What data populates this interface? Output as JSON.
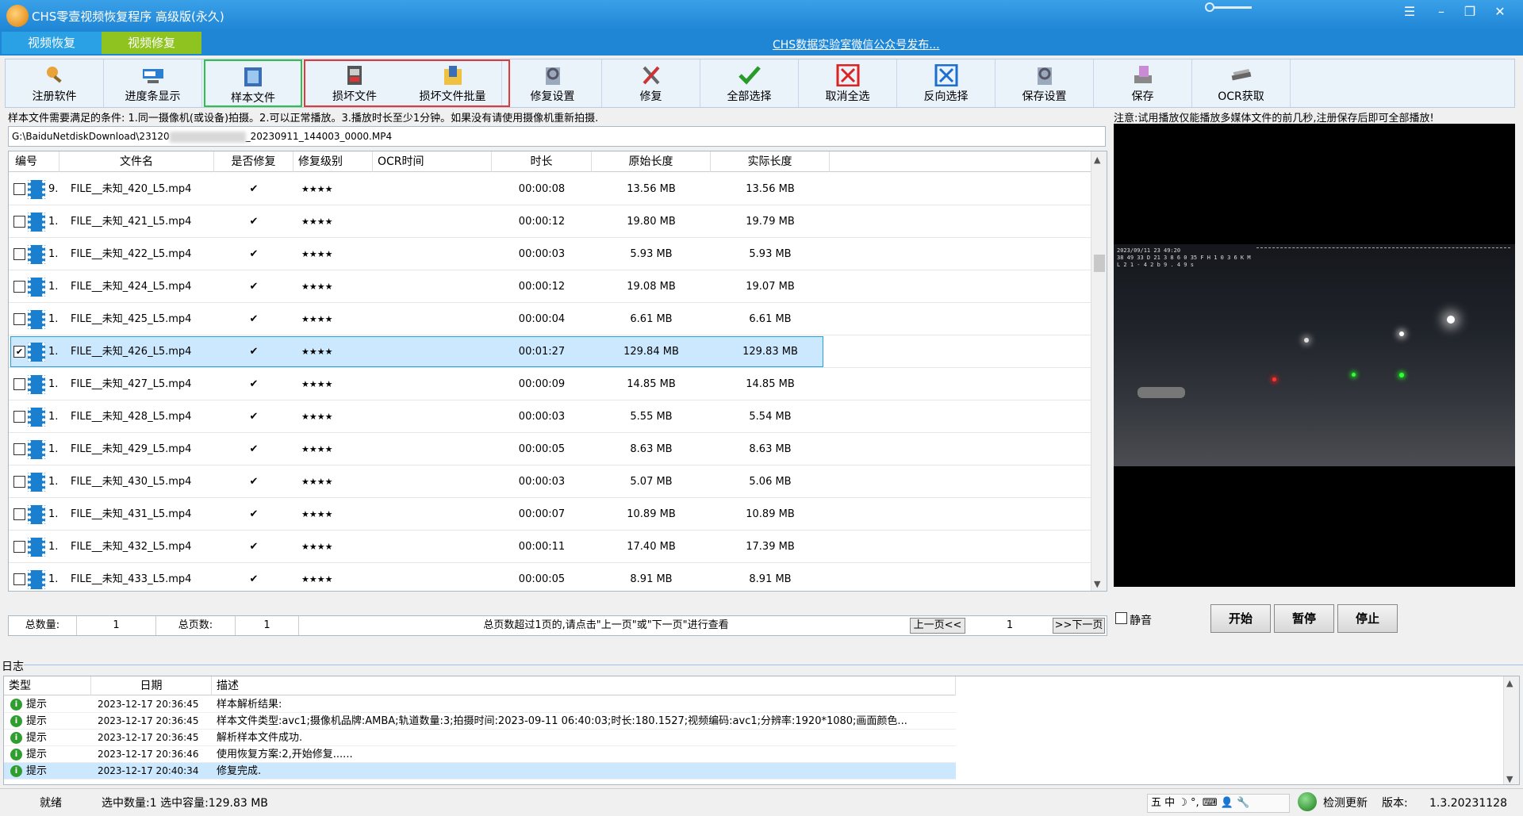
{
  "window": {
    "title": "CHS零壹视频恢复程序 高级版(永久)",
    "minimize": "–",
    "restore": "❐",
    "close": "✕",
    "menu": "☰"
  },
  "tabs": [
    {
      "label": "视频恢复"
    },
    {
      "label": "视频修复"
    }
  ],
  "promo_link": "CHS数据实验室微信公众号发布...",
  "toolbar": [
    {
      "label": "注册软件",
      "icon": "register-icon"
    },
    {
      "label": "进度条显示",
      "icon": "progress-icon"
    },
    {
      "label": "样本文件",
      "icon": "sample-file-icon"
    },
    {
      "label": "损坏文件",
      "icon": "damaged-file-icon"
    },
    {
      "label": "损坏文件批量",
      "icon": "damaged-batch-icon"
    },
    {
      "label": "修复设置",
      "icon": "repair-settings-icon"
    },
    {
      "label": "修复",
      "icon": "repair-icon"
    },
    {
      "label": "全部选择",
      "icon": "check-all-icon"
    },
    {
      "label": "取消全选",
      "icon": "uncheck-all-icon"
    },
    {
      "label": "反向选择",
      "icon": "invert-select-icon"
    },
    {
      "label": "保存设置",
      "icon": "save-settings-icon"
    },
    {
      "label": "保存",
      "icon": "save-icon"
    },
    {
      "label": "OCR获取",
      "icon": "ocr-icon"
    }
  ],
  "notice": "样本文件需要满足的条件: 1.同一摄像机(或设备)拍摄。2.可以正常播放。3.播放时长至少1分钟。如果没有请使用摄像机重新拍摄.",
  "path": {
    "prefix": "G:\\BaiduNetdiskDownload\\23120",
    "suffix": "_20230911_144003_0000.MP4"
  },
  "table": {
    "headers": [
      "编号",
      "文件名",
      "是否修复",
      "修复级别",
      "OCR时间",
      "时长",
      "原始长度",
      "实际长度"
    ],
    "rows": [
      {
        "id": "9.",
        "name": "FILE__未知_420_L5.mp4",
        "fixed": "✔",
        "level": "★★★★",
        "ocr": "",
        "duration": "00:00:08",
        "orig": "13.56 MB",
        "actual": "13.56 MB",
        "checked": false
      },
      {
        "id": "1.",
        "name": "FILE__未知_421_L5.mp4",
        "fixed": "✔",
        "level": "★★★★",
        "ocr": "",
        "duration": "00:00:12",
        "orig": "19.80 MB",
        "actual": "19.79 MB",
        "checked": false
      },
      {
        "id": "1.",
        "name": "FILE__未知_422_L5.mp4",
        "fixed": "✔",
        "level": "★★★★",
        "ocr": "",
        "duration": "00:00:03",
        "orig": "5.93 MB",
        "actual": "5.93 MB",
        "checked": false
      },
      {
        "id": "1.",
        "name": "FILE__未知_424_L5.mp4",
        "fixed": "✔",
        "level": "★★★★",
        "ocr": "",
        "duration": "00:00:12",
        "orig": "19.08 MB",
        "actual": "19.07 MB",
        "checked": false
      },
      {
        "id": "1.",
        "name": "FILE__未知_425_L5.mp4",
        "fixed": "✔",
        "level": "★★★★",
        "ocr": "",
        "duration": "00:00:04",
        "orig": "6.61 MB",
        "actual": "6.61 MB",
        "checked": false
      },
      {
        "id": "1.",
        "name": "FILE__未知_426_L5.mp4",
        "fixed": "✔",
        "level": "★★★★",
        "ocr": "",
        "duration": "00:01:27",
        "orig": "129.84 MB",
        "actual": "129.83 MB",
        "checked": true
      },
      {
        "id": "1.",
        "name": "FILE__未知_427_L5.mp4",
        "fixed": "✔",
        "level": "★★★★",
        "ocr": "",
        "duration": "00:00:09",
        "orig": "14.85 MB",
        "actual": "14.85 MB",
        "checked": false
      },
      {
        "id": "1.",
        "name": "FILE__未知_428_L5.mp4",
        "fixed": "✔",
        "level": "★★★★",
        "ocr": "",
        "duration": "00:00:03",
        "orig": "5.55 MB",
        "actual": "5.54 MB",
        "checked": false
      },
      {
        "id": "1.",
        "name": "FILE__未知_429_L5.mp4",
        "fixed": "✔",
        "level": "★★★★",
        "ocr": "",
        "duration": "00:00:05",
        "orig": "8.63 MB",
        "actual": "8.63 MB",
        "checked": false
      },
      {
        "id": "1.",
        "name": "FILE__未知_430_L5.mp4",
        "fixed": "✔",
        "level": "★★★★",
        "ocr": "",
        "duration": "00:00:03",
        "orig": "5.07 MB",
        "actual": "5.06 MB",
        "checked": false
      },
      {
        "id": "1.",
        "name": "FILE__未知_431_L5.mp4",
        "fixed": "✔",
        "level": "★★★★",
        "ocr": "",
        "duration": "00:00:07",
        "orig": "10.89 MB",
        "actual": "10.89 MB",
        "checked": false
      },
      {
        "id": "1.",
        "name": "FILE__未知_432_L5.mp4",
        "fixed": "✔",
        "level": "★★★★",
        "ocr": "",
        "duration": "00:00:11",
        "orig": "17.40 MB",
        "actual": "17.39 MB",
        "checked": false
      },
      {
        "id": "1.",
        "name": "FILE__未知_433_L5.mp4",
        "fixed": "✔",
        "level": "★★★★",
        "ocr": "",
        "duration": "00:00:05",
        "orig": "8.91 MB",
        "actual": "8.91 MB",
        "checked": false
      }
    ]
  },
  "pager": {
    "total_label": "总数量:",
    "total_value": "1",
    "pages_label": "总页数:",
    "pages_value": "1",
    "hint": "总页数超过1页的,请点击\"上一页\"或\"下一页\"进行查看",
    "prev": "上一页<<",
    "page": "1",
    "next": ">>下一页"
  },
  "preview": {
    "notice": "注意:试用播放仅能播放多媒体文件的前几秒,注册保存后即可全部播放!",
    "osd_line1": "2023/09/11 23 49:20",
    "osd_line2": "38 49 33 D 21 3 8 6 0 35 F H 1 0 3 6 K M",
    "osd_line3": "L 2 1 - 4 2 b  9 . 4 9 s",
    "mute": "静音",
    "start": "开始",
    "pause": "暂停",
    "stop": "停止"
  },
  "log": {
    "label": "日志",
    "headers": [
      "类型",
      "日期",
      "描述"
    ],
    "rows": [
      {
        "type": "提示",
        "date": "2023-12-17 20:36:45",
        "desc": "样本解析结果:"
      },
      {
        "type": "提示",
        "date": "2023-12-17 20:36:45",
        "desc": "样本文件类型:avc1;摄像机品牌:AMBA;轨道数量:3;拍摄时间:2023-09-11 06:40:03;时长:180.1527;视频编码:avc1;分辨率:1920*1080;画面颜色..."
      },
      {
        "type": "提示",
        "date": "2023-12-17 20:36:45",
        "desc": "解析样本文件成功."
      },
      {
        "type": "提示",
        "date": "2023-12-17 20:36:46",
        "desc": "使用恢复方案:2,开始修复......"
      },
      {
        "type": "提示",
        "date": "2023-12-17 20:40:34",
        "desc": "修复完成."
      }
    ]
  },
  "status": {
    "ready": "就绪",
    "selection": "选中数量:1 选中容量:129.83 MB",
    "ime": "五 中 ☽ °, ⌨ 👤 🔧",
    "check_update": "检测更新",
    "version_label": "版本:",
    "version_value": "1.3.20231128"
  },
  "colors": {
    "title_bar": "#1f86d6",
    "tab_active": "#8fc31f",
    "selection": "#cce8ff"
  }
}
